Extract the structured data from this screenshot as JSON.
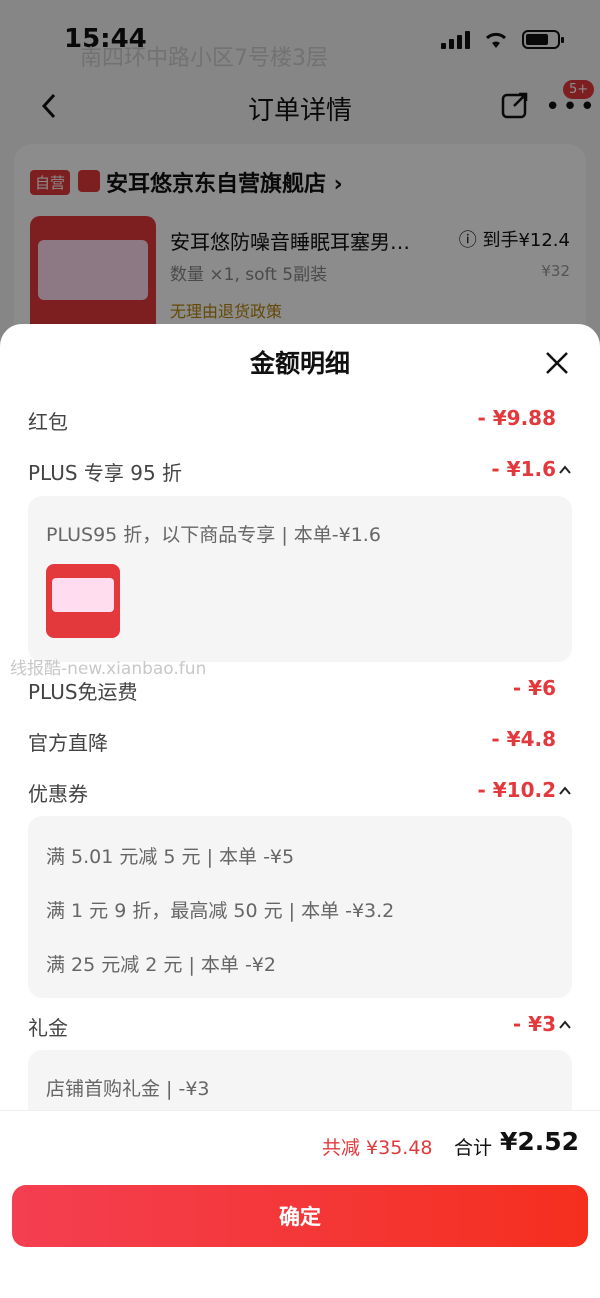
{
  "status": {
    "time": "15:44"
  },
  "background": {
    "ghost_address": "南四环中路小区7号楼3层",
    "nav_title": "订单详情",
    "badge": "5+",
    "store_tag": "自营",
    "store_name": "安耳悠京东自营旗舰店 ›",
    "product_title": "安耳悠防噪音睡眠耳塞男…",
    "product_qty": "数量 ×1, soft 5副装",
    "product_policy": "无理由退货政策",
    "price_final": "ⓘ 到手¥12.4",
    "price_orig": "¥32"
  },
  "sheet": {
    "title": "金额明细",
    "rows": {
      "hongbao": {
        "label": "红包",
        "amount": "- ¥9.88"
      },
      "plus": {
        "label": "PLUS 专享 95 折",
        "amount": "- ¥1.6"
      },
      "plus_detail": {
        "text": "PLUS95 折，以下商品专享 | 本单-¥1.6"
      },
      "plus_free": {
        "label": "PLUS免运费",
        "amount": "- ¥6"
      },
      "official": {
        "label": "官方直降",
        "amount": "- ¥4.8"
      },
      "coupon": {
        "label": "优惠券",
        "amount": "- ¥10.2"
      },
      "coupon_detail": [
        "满 5.01 元减 5 元 | 本单 -¥5",
        "满 1 元 9 折，最高减 50 元 | 本单 -¥3.2",
        "满 25 元减 2 元 | 本单 -¥2"
      ],
      "gift": {
        "label": "礼金",
        "amount": "- ¥3"
      },
      "gift_detail": {
        "text": "店铺首购礼金 | -¥3"
      }
    },
    "watermark": "线报酷-new.xianbao.fun",
    "footer": {
      "save_total": "共减 ¥35.48",
      "sum_label": "合计",
      "sum_value": "¥2.52",
      "confirm": "确定"
    }
  },
  "colors": {
    "accent": "#e4393c"
  }
}
